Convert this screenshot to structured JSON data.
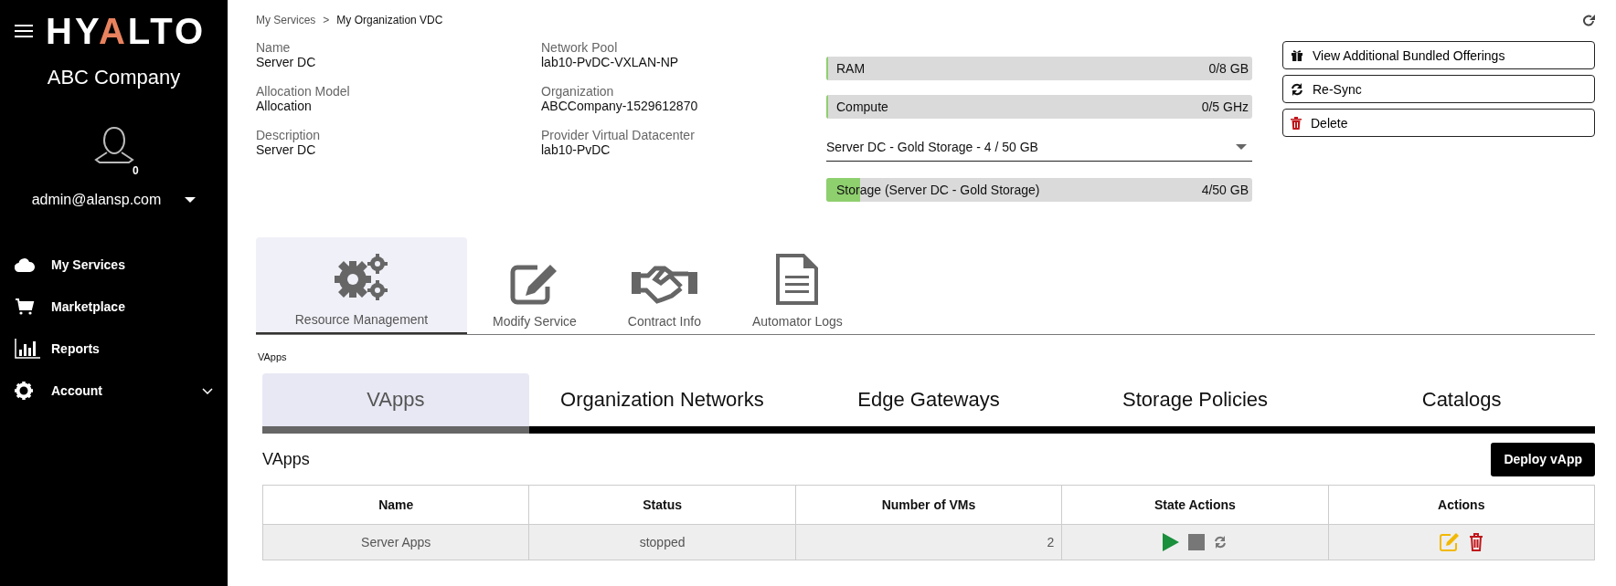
{
  "sidebar": {
    "logo": "HYALTO",
    "company": "ABC Company",
    "user_badge": "0",
    "user": "admin@alansp.com",
    "items": [
      {
        "label": "My Services",
        "kind": "cloud",
        "submenu": false
      },
      {
        "label": "Marketplace",
        "kind": "cart",
        "submenu": false
      },
      {
        "label": "Reports",
        "kind": "chart",
        "submenu": false
      },
      {
        "label": "Account",
        "kind": "gear",
        "submenu": true
      }
    ]
  },
  "breadcrumb": {
    "items": [
      "My Services",
      "My Organization VDC"
    ],
    "separator": ">"
  },
  "details": [
    [
      {
        "label": "Name",
        "value": "Server DC"
      },
      {
        "label": "Allocation Model",
        "value": "Allocation"
      },
      {
        "label": "Description",
        "value": "Server DC"
      }
    ],
    [
      {
        "label": "Network Pool",
        "value": "lab10-PvDC-VXLAN-NP"
      },
      {
        "label": "Organization",
        "value": "ABCCompany-1529612870"
      },
      {
        "label": "Provider Virtual Datacenter",
        "value": "lab10-PvDC"
      }
    ]
  ],
  "resources": [
    {
      "kind": "meter",
      "label": "RAM",
      "reading": "0/8 GB",
      "level": 0
    },
    {
      "kind": "meter",
      "label": "Compute",
      "reading": "0/5 GHz",
      "level": 0
    },
    {
      "kind": "select",
      "value": "Server DC - Gold Storage - 4 / 50 GB"
    },
    {
      "kind": "meter",
      "label": "Storage (Server DC - Gold Storage)",
      "reading": "4/50 GB",
      "level": 0.08
    }
  ],
  "actions": [
    {
      "label": "View Additional Bundled Offerings",
      "kind": "gift"
    },
    {
      "label": "Re-Sync",
      "kind": "sync"
    },
    {
      "label": "Delete",
      "kind": "trash"
    }
  ],
  "main_tabs": [
    {
      "label": "Resource Management",
      "kind": "gears",
      "selected": true
    },
    {
      "label": "Modify Service",
      "kind": "edit",
      "selected": false
    },
    {
      "label": "Contract Info",
      "kind": "handshake",
      "selected": false
    },
    {
      "label": "Automator Logs",
      "kind": "document",
      "selected": false
    }
  ],
  "section_label": "VApps",
  "sub_tabs": [
    {
      "label": "VApps",
      "selected": true
    },
    {
      "label": "Organization Networks",
      "selected": false
    },
    {
      "label": "Edge Gateways",
      "selected": false
    },
    {
      "label": "Storage Policies",
      "selected": false
    },
    {
      "label": "Catalogs",
      "selected": false
    }
  ],
  "table": {
    "title": "VApps",
    "deploy_button": "Deploy vApp",
    "columns": [
      "Name",
      "Status",
      "Number of VMs",
      "State Actions",
      "Actions"
    ],
    "rows": [
      {
        "cells": [
          "Server Apps",
          "stopped",
          "2"
        ]
      }
    ]
  }
}
